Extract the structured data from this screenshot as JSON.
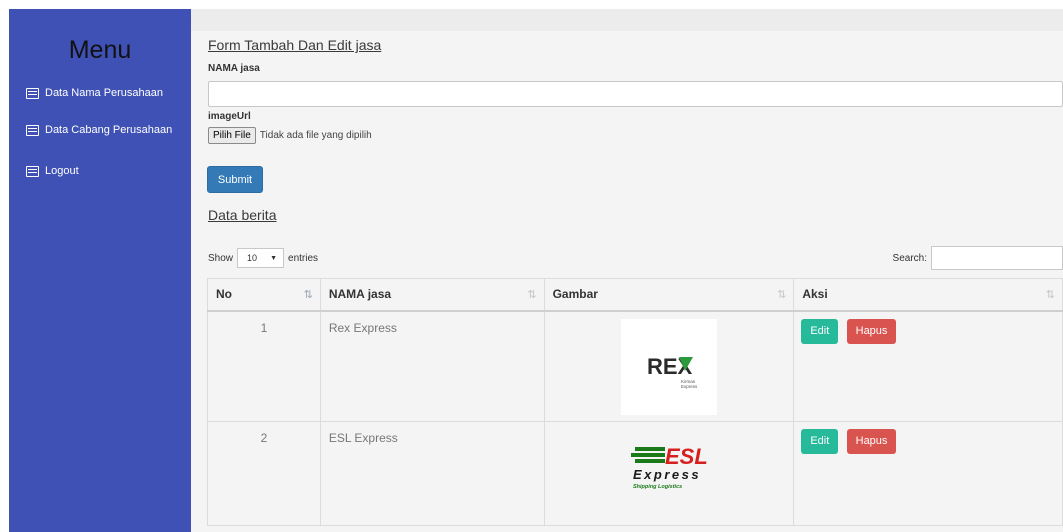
{
  "sidebar": {
    "title": "Menu",
    "items": [
      {
        "label": "Data Nama Perusahaan",
        "icon": "list-icon"
      },
      {
        "label": "Data Cabang Perusahaan",
        "icon": "list-icon"
      },
      {
        "label": "Logout",
        "icon": "list-icon"
      }
    ]
  },
  "form": {
    "heading": "Form Tambah Dan Edit jasa",
    "name_label": "NAMA jasa",
    "name_value": "",
    "image_label": "imageUrl",
    "file_button": "Pilih File",
    "file_status": "Tidak ada file yang dipilih",
    "submit_label": "Submit"
  },
  "table_section": {
    "heading": "Data berita",
    "show_label": "Show",
    "entries_value": "10",
    "entries_label": "entries",
    "search_label": "Search:",
    "search_value": "",
    "columns": [
      "No",
      "NAMA jasa",
      "Gambar",
      "Aksi"
    ],
    "rows": [
      {
        "no": "1",
        "name": "Rex Express",
        "logo": "rex-express-logo",
        "logo_text": "REX",
        "logo_sub1": "Kirman",
        "logo_sub2": "Express"
      },
      {
        "no": "2",
        "name": "ESL Express",
        "logo": "esl-express-logo",
        "logo_text": "ESL",
        "logo_sub1": "Express",
        "logo_sub2": "Shipping Logistics"
      }
    ],
    "edit_label": "Edit",
    "delete_label": "Hapus"
  },
  "colors": {
    "sidebar_bg": "#3f51b5",
    "primary": "#337ab7",
    "edit": "#26b99a",
    "delete": "#d9534f",
    "esl_green": "#1a7a1a",
    "esl_red": "#d62020"
  }
}
